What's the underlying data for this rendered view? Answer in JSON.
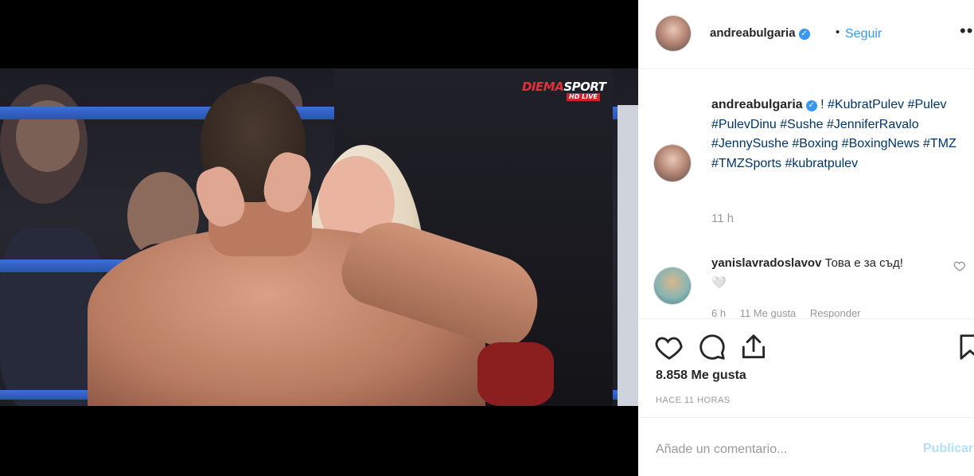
{
  "video": {
    "logo_main_red": "DIEMA",
    "logo_main_white": "SPORT",
    "logo_sub": "HD LIVE"
  },
  "header": {
    "username": "andreabulgaria",
    "verified_symbol": "✓",
    "separator": "•",
    "follow_label": "Seguir",
    "more_icon": "•••"
  },
  "caption": {
    "username": "andreabulgaria",
    "prefix": " ! ",
    "hashtags": "#KubratPulev #Pulev #PulevDinu #Sushe #JenniferRavalo #JennySushe #Boxing #BoxingNews #TMZ #TMZSports #kubratpulev",
    "time": "11 h"
  },
  "comment": {
    "username": "yanislavradoslavov",
    "text": " Това е за съд! 🤍",
    "time": "6 h",
    "likes": "11 Me gusta",
    "reply": "Responder"
  },
  "actions": {
    "likes_count": "8.858 Me gusta",
    "posted": "HACE 11 HORAS"
  },
  "add_comment": {
    "placeholder": "Añade un comentario...",
    "publish_label": "Publicar"
  },
  "colors": {
    "accent": "#3897f0",
    "hashtag": "#003569",
    "muted": "#999999",
    "publish_disabled": "#b2dffc"
  }
}
